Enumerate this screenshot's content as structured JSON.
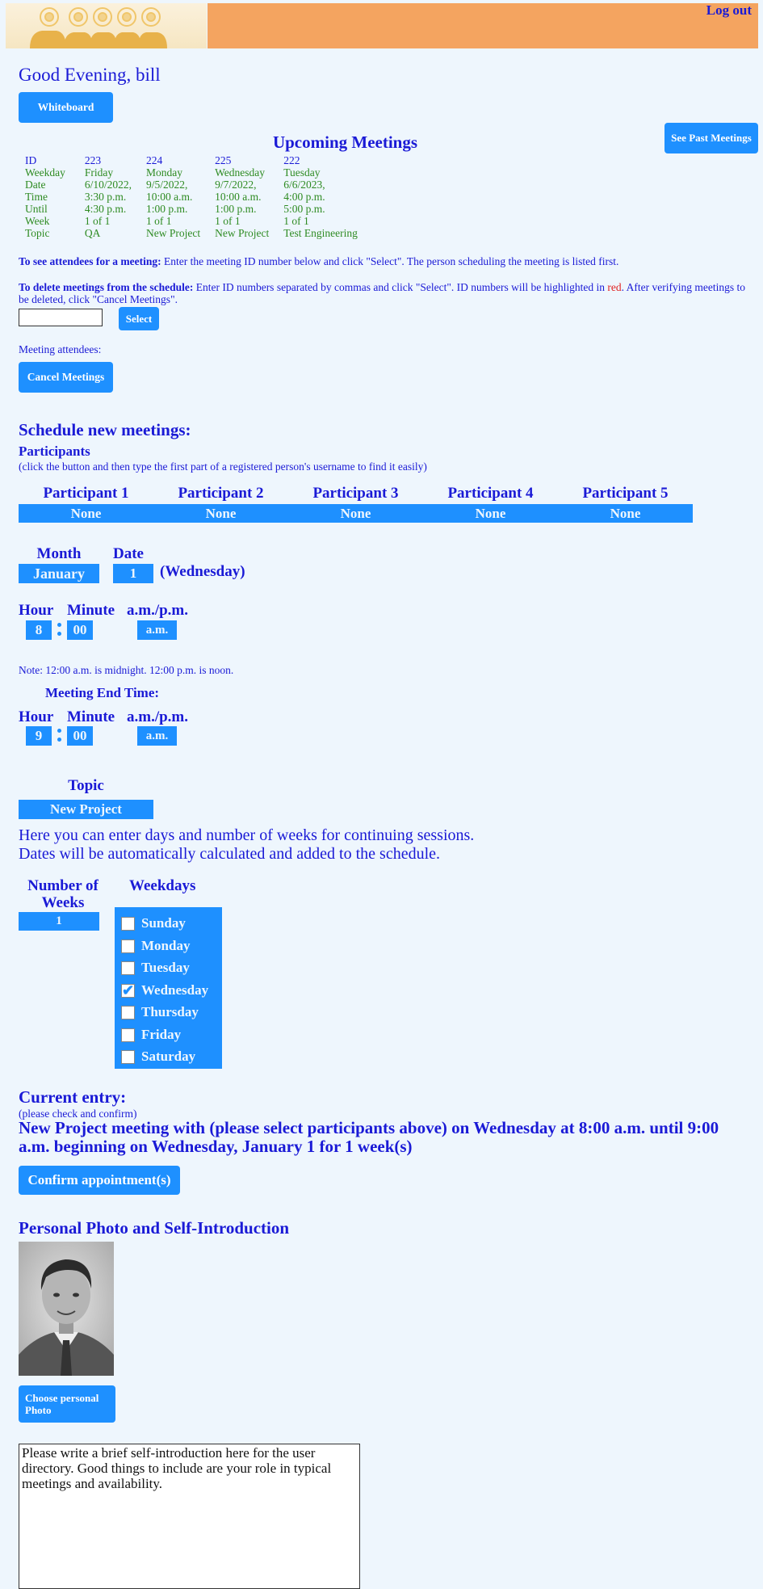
{
  "header": {
    "logout_label": "Log out"
  },
  "greeting": "Good Evening, bill",
  "buttons": {
    "whiteboard": "Whiteboard",
    "past_meetings": "See Past Meetings",
    "select": "Select",
    "cancel_meetings": "Cancel Meetings",
    "confirm": "Confirm appointment(s)",
    "choose_photo": "Choose personal Photo"
  },
  "upcoming": {
    "title": "Upcoming Meetings",
    "row_labels": [
      "ID",
      "Weekday",
      "Date",
      "Time",
      "Until",
      "Week",
      "Topic"
    ],
    "meetings": [
      {
        "id": "223",
        "weekday": "Friday",
        "date": "6/10/2022,",
        "time": "3:30 p.m.",
        "until": "4:30 p.m.",
        "week": "1 of 1",
        "topic": "QA"
      },
      {
        "id": "224",
        "weekday": "Monday",
        "date": "9/5/2022,",
        "time": "10:00 a.m.",
        "until": "1:00 p.m.",
        "week": "1 of 1",
        "topic": "New Project"
      },
      {
        "id": "225",
        "weekday": "Wednesday",
        "date": "9/7/2022,",
        "time": "10:00 a.m.",
        "until": "1:00 p.m.",
        "week": "1 of 1",
        "topic": "New Project"
      },
      {
        "id": "222",
        "weekday": "Tuesday",
        "date": "6/6/2023,",
        "time": "4:00 p.m.",
        "until": "5:00 p.m.",
        "week": "1 of 1",
        "topic": "Test Engineering"
      }
    ]
  },
  "instructions": {
    "attendees_bold": "To see attendees for a meeting:",
    "attendees_text": " Enter the meeting ID number below and click \"Select\". The person scheduling the meeting is listed first.",
    "delete_bold": "To delete meetings from the schedule:",
    "delete_text_1": " Enter ID numbers separated by commas and click \"Select\". ID numbers will be highlighted in ",
    "delete_red": "red",
    "delete_text_2": ". After verifying meetings to be deleted, click \"Cancel Meetings\".",
    "id_input_value": "",
    "attendees_label": "Meeting attendees:"
  },
  "schedule": {
    "title": "Schedule new meetings:",
    "participants_title": "Participants",
    "participants_hint": "(click the button and then type the first part of a registered person's username to find it easily)",
    "participants": [
      {
        "label": "Participant 1",
        "value": "None"
      },
      {
        "label": "Participant 2",
        "value": "None"
      },
      {
        "label": "Participant 3",
        "value": "None"
      },
      {
        "label": "Participant 4",
        "value": "None"
      },
      {
        "label": "Participant 5",
        "value": "None"
      }
    ],
    "month_label": "Month",
    "month_value": "January",
    "date_label": "Date",
    "date_value": "1",
    "date_weekday": "(Wednesday)",
    "start": {
      "hour_label": "Hour",
      "hour": "8",
      "minute_label": "Minute",
      "minute": "00",
      "ampm_label": "a.m./p.m.",
      "ampm": "a.m."
    },
    "note": "Note: 12:00 a.m. is midnight. 12:00 p.m. is noon.",
    "end_title": "Meeting End Time:",
    "end": {
      "hour_label": "Hour",
      "hour": "9",
      "minute_label": "Minute",
      "minute": "00",
      "ampm_label": "a.m./p.m.",
      "ampm": "a.m."
    },
    "topic_label": "Topic",
    "topic_value": "New Project",
    "continuing_line1": "Here you can enter days and number of weeks for continuing sessions.",
    "continuing_line2": "Dates will be automatically calculated and added to the schedule.",
    "weeks_label": "Number of Weeks",
    "weeks_value": "1",
    "weekdays_label": "Weekdays",
    "weekdays": [
      {
        "name": "Sunday",
        "checked": false
      },
      {
        "name": "Monday",
        "checked": false
      },
      {
        "name": "Tuesday",
        "checked": false
      },
      {
        "name": "Wednesday",
        "checked": true
      },
      {
        "name": "Thursday",
        "checked": false
      },
      {
        "name": "Friday",
        "checked": false
      },
      {
        "name": "Saturday",
        "checked": false
      }
    ]
  },
  "current_entry": {
    "title": "Current entry:",
    "hint": "(please check and confirm)",
    "summary": "New Project meeting with (please select participants above) on Wednesday at 8:00 a.m. until 9:00 a.m. beginning on Wednesday, January 1 for 1 week(s)"
  },
  "profile": {
    "title": "Personal Photo and Self-Introduction",
    "intro_placeholder": "Please write a brief self-introduction here for the user directory. Good things to include are your role in typical meetings and availability."
  },
  "colors": {
    "accent": "#1e90ff",
    "banner": "#f4a460",
    "text_blue": "#1a1ad6",
    "text_green": "#2e8b22",
    "highlight_red": "#e02020",
    "background": "#eef6fd"
  }
}
